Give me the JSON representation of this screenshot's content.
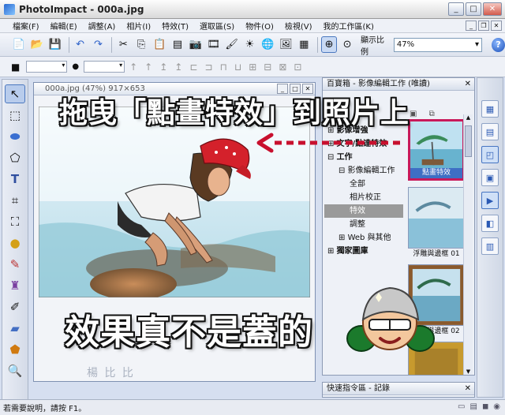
{
  "window": {
    "title": "PhotoImpact - 000a.jpg"
  },
  "menu": [
    "檔案(F)",
    "編輯(E)",
    "調整(A)",
    "相片(I)",
    "特效(T)",
    "選取區(S)",
    "物件(O)",
    "檢視(V)",
    "我的工作區(K)"
  ],
  "toolbar": {
    "zoom_label": "顯示比例",
    "zoom_value": "47%"
  },
  "document": {
    "title": "000a.jpg (47%) 917×653"
  },
  "panel": {
    "title": "百寶箱 - 影像編輯工作 (唯讀)",
    "tree": [
      {
        "label": "影像增強",
        "level": 0,
        "prefix": "⊞"
      },
      {
        "label": "文字/點達特效",
        "level": 0,
        "prefix": "⊞"
      },
      {
        "label": "工作",
        "level": 0,
        "prefix": "⊟"
      },
      {
        "label": "影像編輯工作",
        "level": 1,
        "prefix": "⊟"
      },
      {
        "label": "全部",
        "level": 2,
        "prefix": ""
      },
      {
        "label": "相片校正",
        "level": 2,
        "prefix": ""
      },
      {
        "label": "特效",
        "level": 2,
        "prefix": "",
        "selected": true
      },
      {
        "label": "調整",
        "level": 2,
        "prefix": ""
      },
      {
        "label": "Web 與其他",
        "level": 1,
        "prefix": "⊞"
      },
      {
        "label": "獨家圖庫",
        "level": 0,
        "prefix": "⊞"
      }
    ],
    "thumbnails": [
      {
        "label": "點畫特效",
        "highlighted": true
      },
      {
        "label": "浮雕與邊框 01",
        "highlighted": false
      },
      {
        "label": "浮雕與邊框 02",
        "highlighted": false
      },
      {
        "label": "",
        "highlighted": false
      }
    ],
    "bottom_title": "快速指令區 - 記錄"
  },
  "annotations": {
    "headline": "拖曳「點畫特效」到照片上",
    "bottomline": "效果真不是蓋的",
    "watermark": "楊 比 比"
  },
  "status": {
    "text": "若需要說明，請按 F1。"
  },
  "colors": {
    "accent": "#3e6fc4",
    "highlight_box": "#c8195a",
    "arrow": "#c8102e"
  }
}
